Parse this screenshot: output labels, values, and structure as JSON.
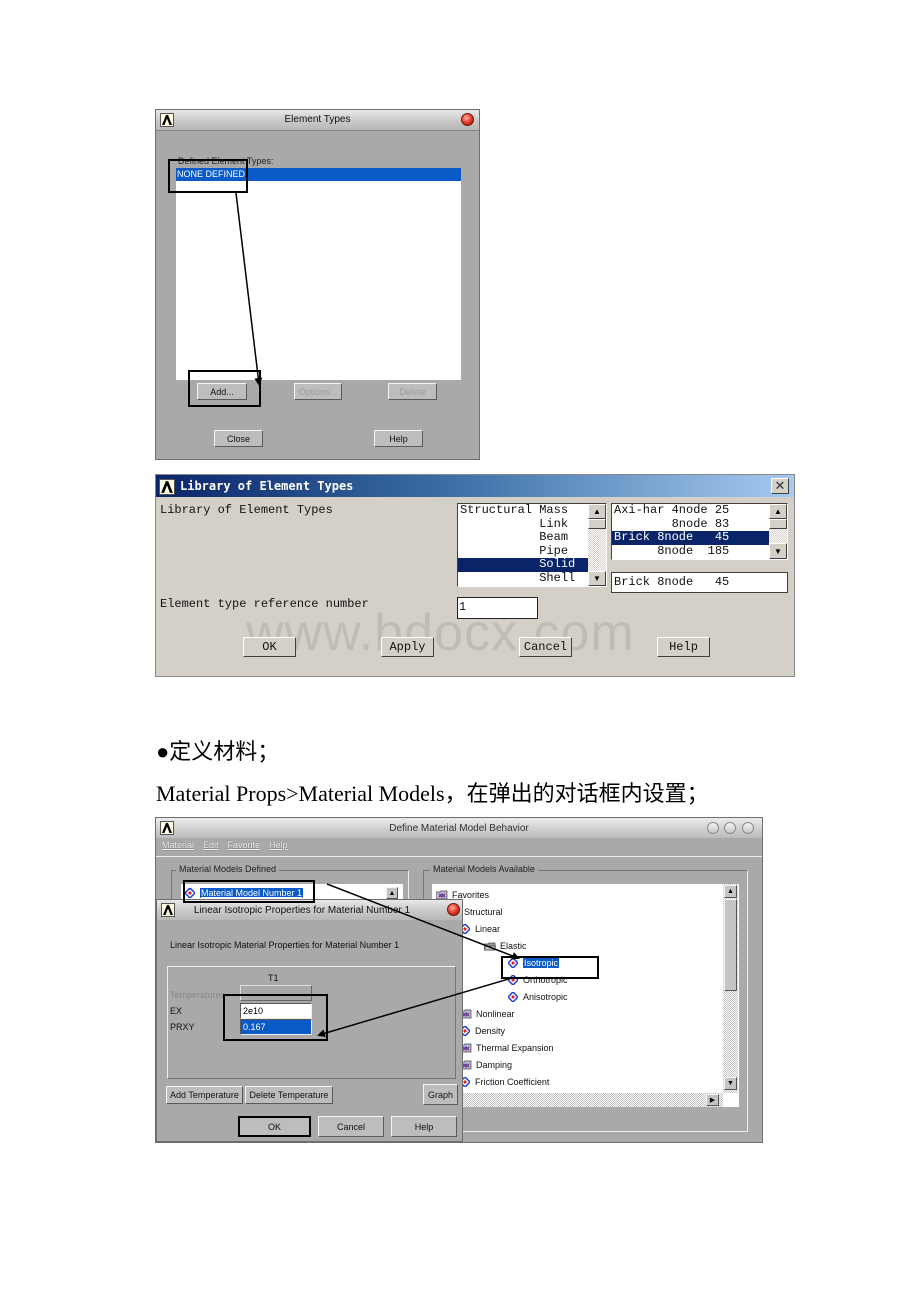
{
  "element_types_dialog": {
    "title": "Element Types",
    "list_label": "Defined Element Types:",
    "list_items": [
      "NONE DEFINED"
    ],
    "buttons": {
      "add": "Add...",
      "options": "Options...",
      "delete": "Delete",
      "close": "Close",
      "help": "Help"
    }
  },
  "library_dialog": {
    "title": "Library of Element Types",
    "label_library": "Library of Element Types",
    "categories": [
      "Structural Mass",
      "           Link",
      "           Beam",
      "           Pipe",
      "           Solid",
      "           Shell"
    ],
    "selected_category": "Solid",
    "element_list": [
      "Axi-har 4node 25",
      "        8node 83",
      "Brick 8node   45",
      "      8node  185"
    ],
    "selected_element": "Brick 8node   45",
    "selection_display": "Brick 8node   45",
    "ref_label": "Element type reference number",
    "ref_value": "1",
    "buttons": {
      "ok": "OK",
      "apply": "Apply",
      "cancel": "Cancel",
      "help": "Help"
    },
    "watermark": "www.bdocx.com"
  },
  "doc_text": {
    "bullet": "●",
    "heading": "定义材料；",
    "instruction": "Material Props>Material Models，在弹出的对话框内设置；"
  },
  "material_behavior_dialog": {
    "title": "Define Material Model Behavior",
    "menu": [
      "Material",
      "Edit",
      "Favorite",
      "Help"
    ],
    "defined_group_label": "Material Models Defined",
    "defined_items": [
      "Material Model Number 1"
    ],
    "available_group_label": "Material Models Available",
    "tree": [
      {
        "label": "Favorites",
        "icon": "folder-icon"
      },
      {
        "label": "Structural",
        "icon": "folder-icon"
      },
      {
        "label": "Linear",
        "icon": "material-icon"
      },
      {
        "label": "Elastic",
        "icon": "open-folder-icon"
      },
      {
        "label": "Isotropic",
        "icon": "material-icon",
        "selected": true
      },
      {
        "label": "Orthotropic",
        "icon": "material-icon"
      },
      {
        "label": "Anisotropic",
        "icon": "material-icon"
      },
      {
        "label": "Nonlinear",
        "icon": "folder-icon"
      },
      {
        "label": "Density",
        "icon": "material-icon"
      },
      {
        "label": "Thermal Expansion",
        "icon": "folder-icon"
      },
      {
        "label": "Damping",
        "icon": "folder-icon"
      },
      {
        "label": "Friction Coefficient",
        "icon": "material-icon"
      }
    ]
  },
  "isotropic_dialog": {
    "title": "Linear Isotropic Properties for Material Number 1",
    "heading": "Linear Isotropic Material Properties for Material Number 1",
    "column": "T1",
    "rows": [
      {
        "label": "Temperatures",
        "value": ""
      },
      {
        "label": "EX",
        "value": "2e10"
      },
      {
        "label": "PRXY",
        "value": "0.167"
      }
    ],
    "buttons": {
      "add_temp": "Add Temperature",
      "delete_temp": "Delete Temperature",
      "graph": "Graph",
      "ok": "OK",
      "cancel": "Cancel",
      "help": "Help"
    }
  }
}
